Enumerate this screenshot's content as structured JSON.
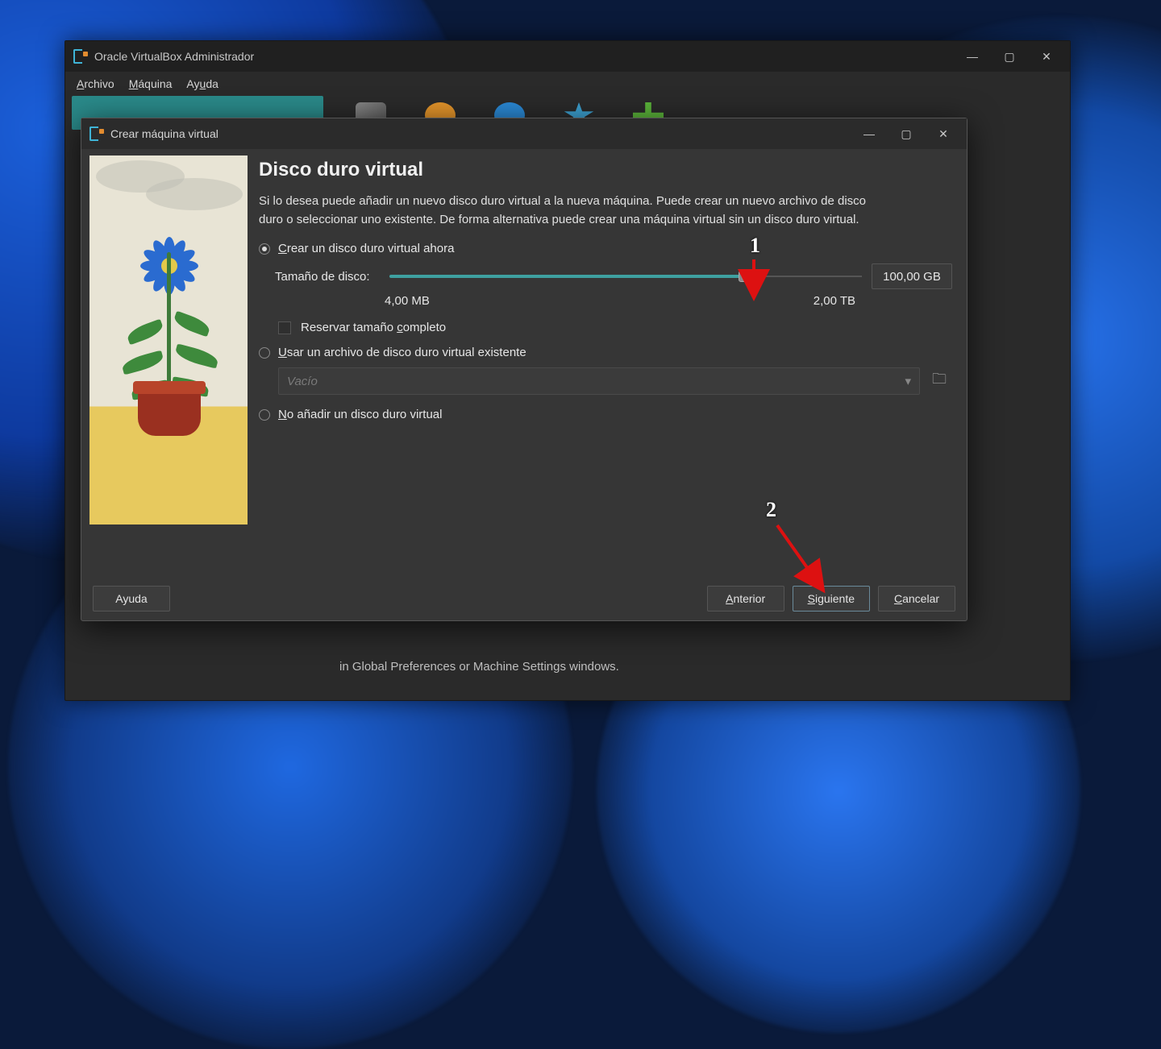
{
  "mainWindow": {
    "title": "Oracle VirtualBox Administrador",
    "menu": {
      "file": "Archivo",
      "machine": "Máquina",
      "help": "Ayuda"
    },
    "bottomText": "in Global Preferences or Machine Settings windows."
  },
  "dialog": {
    "title": "Crear máquina virtual",
    "heading": "Disco duro virtual",
    "description": "Si lo desea puede añadir un nuevo disco duro virtual a la nueva máquina. Puede crear un nuevo archivo de disco duro o seleccionar uno existente. De forma alternativa puede crear una máquina virtual sin un disco duro virtual.",
    "options": {
      "createNow": "Crear un disco duro virtual ahora",
      "useExisting": "Usar un archivo de disco duro virtual existente",
      "noDisk": "No añadir un disco duro virtual"
    },
    "diskSize": {
      "label": "Tamaño de disco:",
      "min": "4,00 MB",
      "max": "2,00 TB",
      "value": "100,00 GB",
      "sliderPercent": 75
    },
    "reserveFull": "Reservar tamaño completo",
    "combo": {
      "placeholder": "Vacío"
    },
    "buttons": {
      "help": "Ayuda",
      "back": "Anterior",
      "next": "Siguiente",
      "cancel": "Cancelar"
    }
  },
  "annotations": {
    "one": "1",
    "two": "2"
  }
}
